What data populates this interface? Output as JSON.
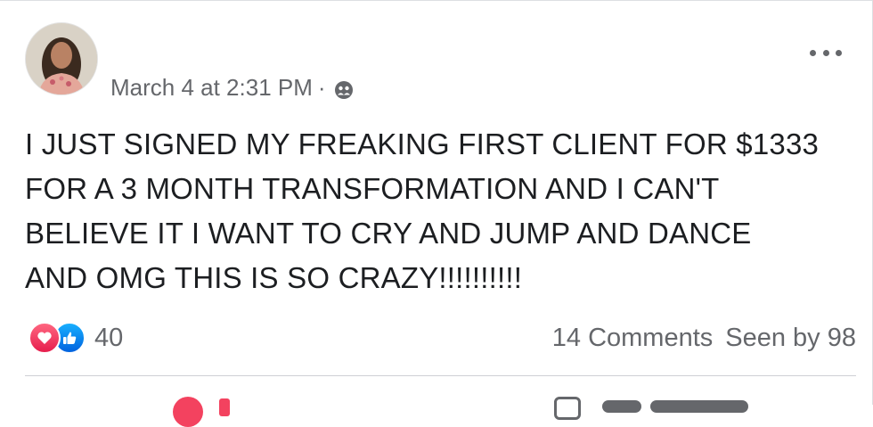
{
  "post": {
    "timestamp": "March 4 at 2:31 PM",
    "separator": "·",
    "audience_icon": "group-icon",
    "more_icon": "more-options-icon",
    "text": "I JUST SIGNED MY FREAKING FIRST CLIENT FOR $1333\nFOR A 3 MONTH TRANSFORMATION AND I CAN'T\nBELIEVE IT I WANT TO CRY AND JUMP AND DANCE\nAND OMG THIS IS SO CRAZY!!!!!!!!!!"
  },
  "reactions": {
    "icons": [
      "love-reaction-icon",
      "like-reaction-icon"
    ],
    "count": "40"
  },
  "stats": {
    "comments": "14 Comments",
    "seen_by": "Seen by 98"
  },
  "colors": {
    "text": "#1c1e21",
    "secondary": "#65676b",
    "love": "#f3425f",
    "like": "#1877f2"
  }
}
